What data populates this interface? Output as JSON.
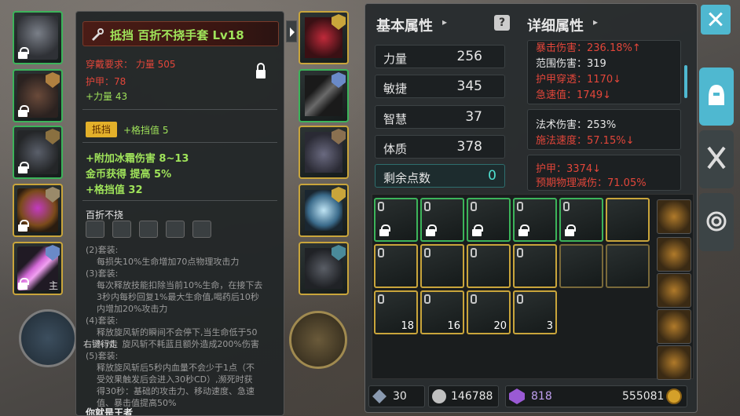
{
  "tooltip": {
    "item_title": "抵挡  百折不挠手套  Lv18",
    "requirement": "穿戴要求：    力量 505",
    "armor": "护甲：78",
    "strength": "+力量 43",
    "tag": "抵挡",
    "block_stat": "+格挡值 5",
    "affix1": "+附加冰霜伤害  8~13",
    "affix2": "金币获得 提高 5%",
    "affix3": "+格挡值 32",
    "set_name": "百折不挠",
    "set_lines": "(2)套装:\n    每损失10%生命增加70点物理攻击力\n(3)套装:\n    每次释放技能扣除当前10%生命，在接下去\n    3秒内每秒回复1%最大生命值,喝药后10秒\n    内增加20%攻击力\n(4)套装:\n    释放旋风斩的瞬间不会停下,当生命低于50\n    %时，旋风斩不耗蓝且额外造成200%伤害\n(5)套装:\n    释放旋风斩后5秒内血量不会少于1点（不\n    受效果触发后会进入30秒CD）,濒死时获\n    得30秒：基础的攻击力、移动速度、急速\n    值、暴击值提高50%",
    "footer": "你就是王者"
  },
  "left_slots": {
    "main_label": "主"
  },
  "stats": {
    "basic_header": "基本属性",
    "detail_header": "详细属性",
    "header_arrow": "▸",
    "rows": [
      {
        "label": "力量",
        "value": "256"
      },
      {
        "label": "敏捷",
        "value": "345"
      },
      {
        "label": "智慧",
        "value": "37"
      },
      {
        "label": "体质",
        "value": "378"
      }
    ],
    "remaining_label": "剩余点数",
    "remaining_value": "0",
    "detail_box1": [
      {
        "text": "暴击伤害：236.18%↑",
        "color": "#e2463a"
      },
      {
        "text": "范围伤害：319",
        "color": "#e6e6e6"
      },
      {
        "text": "护甲穿透：1170↓",
        "color": "#e2463a"
      },
      {
        "text": "急速值：1749↓",
        "color": "#e2463a"
      }
    ],
    "detail_box2": [
      {
        "text": "法术伤害：253%",
        "color": "#e6e6e6"
      },
      {
        "text": "施法速度：57.15%↓",
        "color": "#e2463a"
      }
    ],
    "detail_box3": [
      {
        "text": "护甲：3374↓",
        "color": "#e2463a"
      },
      {
        "text": "预期物理减伤：71.05%",
        "color": "#e2463a"
      }
    ]
  },
  "inventory": {
    "row3_qty": [
      "18",
      "16",
      "20",
      "3"
    ]
  },
  "currency": {
    "shards": "30",
    "silver": "146788",
    "gems": "818",
    "gold": "555081"
  },
  "overlay": {
    "auto_walk": "右键行走"
  },
  "colors": {
    "accent": "#4fb8d0",
    "green_border": "#3cb45a",
    "gold_border": "#c9a53b",
    "title_green": "#9fe35a",
    "stat_red": "#e2463a"
  }
}
